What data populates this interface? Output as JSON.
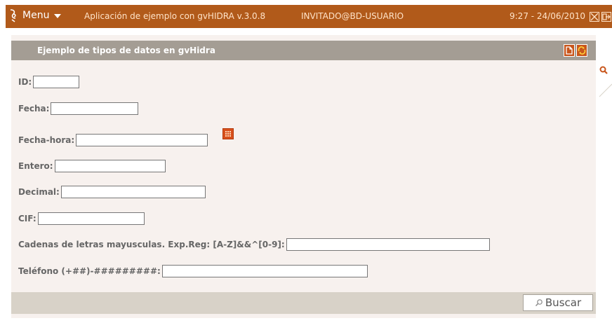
{
  "topbar": {
    "menu_label": "Menu",
    "app_title": "Aplicación de ejemplo con gvHIDRA  v.3.0.8",
    "user": "INVITADO@BD-USUARIO",
    "datetime": "9:27 - 24/06/2010",
    "bg_color": "#b15a1a"
  },
  "panel": {
    "title": "Ejemplo de tipos de datos en gvHidra",
    "header_buttons": [
      "new-document-icon",
      "refresh-icon"
    ]
  },
  "form": {
    "id_label": "ID:",
    "id_value": "",
    "fecha_label": "Fecha:",
    "fecha_value": "",
    "fechahora_label": "Fecha-hora:",
    "fechahora_value": "",
    "entero_label": "Entero:",
    "entero_value": "",
    "decimal_label": "Decimal:",
    "decimal_value": "",
    "cif_label": "CIF:",
    "cif_value": "",
    "cadenas_label": "Cadenas de letras mayusculas. Exp.Reg: [A-Z]&&^[0-9]:",
    "cadenas_value": "",
    "telefono_label": "Teléfono (+##)-#########:",
    "telefono_value": ""
  },
  "footer": {
    "search_button_label": "Buscar"
  },
  "colors": {
    "accent": "#c8551b",
    "panel_bg": "#f7f1ee",
    "header_bg": "#a49d94",
    "footer_bg": "#d8d2c8"
  }
}
